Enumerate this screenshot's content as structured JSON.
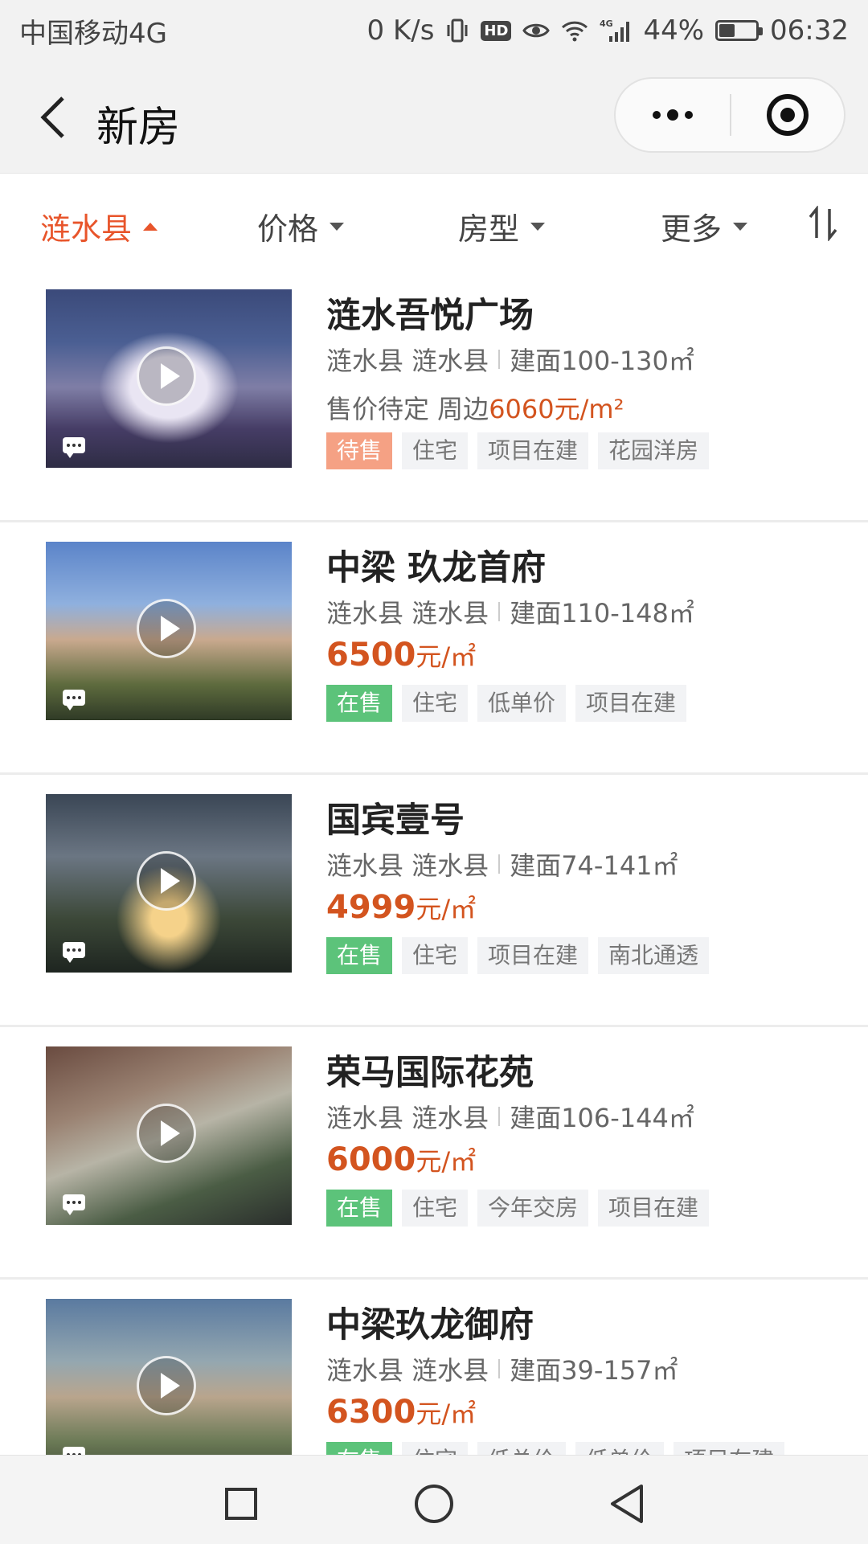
{
  "status_bar": {
    "carrier": "中国移动4G",
    "speed": "0 K/s",
    "hd": "HD",
    "network": "4G",
    "battery_percent_text": "44%",
    "battery_level": 0.44,
    "time": "06:32"
  },
  "nav": {
    "title": "新房"
  },
  "filters": [
    {
      "label": "涟水县",
      "active": true
    },
    {
      "label": "价格",
      "active": false
    },
    {
      "label": "房型",
      "active": false
    },
    {
      "label": "更多",
      "active": false
    }
  ],
  "listings": [
    {
      "name": "涟水吾悦广场",
      "district": "涟水县 涟水县",
      "area": "建面100-130㎡",
      "price_prefix": "售价待定 周边",
      "price_highlight": "6060元/m²",
      "tags": [
        {
          "label": "待售",
          "style": "salmon"
        },
        {
          "label": "住宅",
          "style": "plain"
        },
        {
          "label": "项目在建",
          "style": "plain"
        },
        {
          "label": "花园洋房",
          "style": "plain"
        }
      ]
    },
    {
      "name": "中梁 玖龙首府",
      "district": "涟水县 涟水县",
      "area": "建面110-148㎡",
      "price": "6500",
      "price_unit": "元/㎡",
      "tags": [
        {
          "label": "在售",
          "style": "green"
        },
        {
          "label": "住宅",
          "style": "plain"
        },
        {
          "label": "低单价",
          "style": "plain"
        },
        {
          "label": "项目在建",
          "style": "plain"
        }
      ]
    },
    {
      "name": "国宾壹号",
      "district": "涟水县 涟水县",
      "area": "建面74-141㎡",
      "price": "4999",
      "price_unit": "元/㎡",
      "tags": [
        {
          "label": "在售",
          "style": "green"
        },
        {
          "label": "住宅",
          "style": "plain"
        },
        {
          "label": "项目在建",
          "style": "plain"
        },
        {
          "label": "南北通透",
          "style": "plain"
        }
      ]
    },
    {
      "name": "荣马国际花苑",
      "district": "涟水县 涟水县",
      "area": "建面106-144㎡",
      "price": "6000",
      "price_unit": "元/㎡",
      "tags": [
        {
          "label": "在售",
          "style": "green"
        },
        {
          "label": "住宅",
          "style": "plain"
        },
        {
          "label": "今年交房",
          "style": "plain"
        },
        {
          "label": "项目在建",
          "style": "plain"
        }
      ]
    },
    {
      "name": "中梁玖龙御府",
      "district": "涟水县 涟水县",
      "area": "建面39-157㎡",
      "price": "6300",
      "price_unit": "元/㎡",
      "tags": [
        {
          "label": "在售",
          "style": "green"
        },
        {
          "label": "住宅",
          "style": "plain"
        },
        {
          "label": "低总价",
          "style": "plain"
        },
        {
          "label": "低单价",
          "style": "plain"
        },
        {
          "label": "项目在建",
          "style": "plain"
        }
      ]
    }
  ],
  "colors": {
    "accent": "#e8552b",
    "price": "#d3541f",
    "on_sale": "#5cc37a",
    "pending": "#f5a184"
  },
  "icons": {
    "back": "chevron-left-icon",
    "more": "more-dots-icon",
    "close": "target-close-icon",
    "sort": "sort-arrows-icon",
    "video": "play-icon",
    "comment": "chat-bubble-icon"
  }
}
